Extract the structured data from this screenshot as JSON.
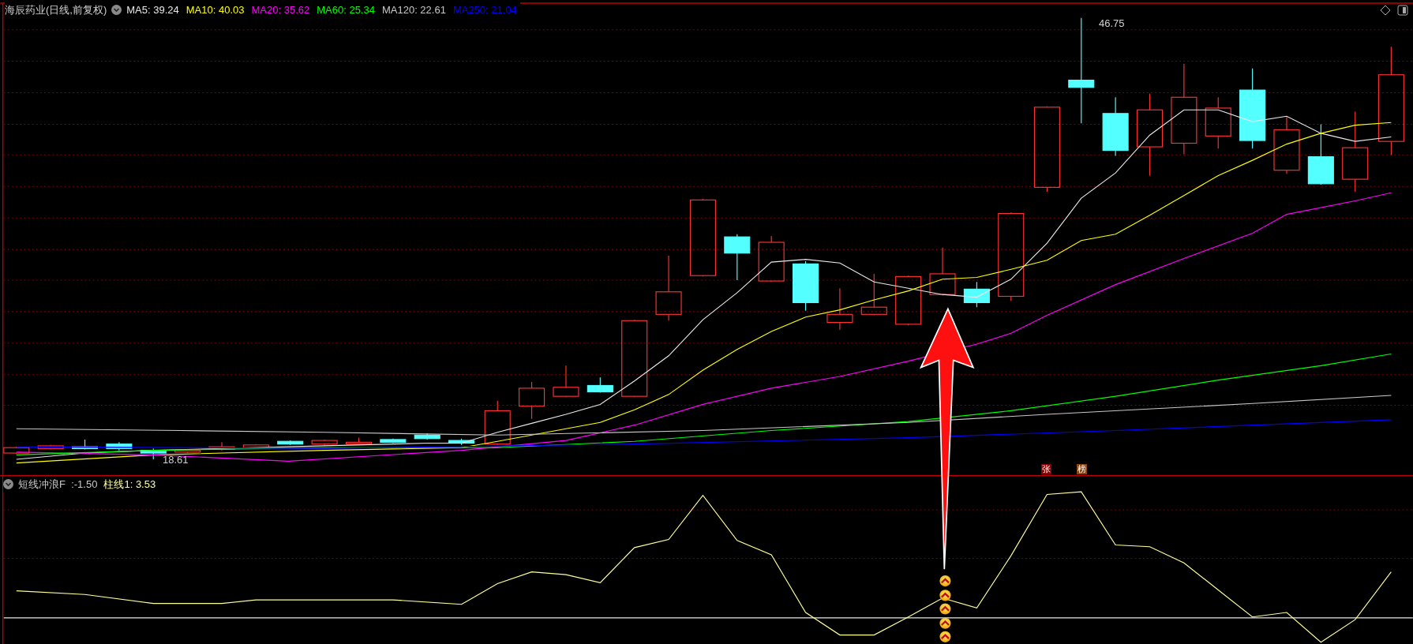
{
  "title": "海辰药业(日线,前复权)",
  "moving_averages": [
    {
      "label": "MA5: 39.24",
      "color": "#e8e8e8"
    },
    {
      "label": "MA10: 40.03",
      "color": "#ffff00"
    },
    {
      "label": "MA20: 35.62",
      "color": "#ff00ff"
    },
    {
      "label": "MA60: 25.34",
      "color": "#00ff00"
    },
    {
      "label": "MA120: 22.61",
      "color": "#c8c8c8"
    },
    {
      "label": "MA250: 21.04",
      "color": "#0000ff"
    }
  ],
  "high_label": "46.75",
  "low_label": "18.61",
  "indicator": {
    "items": [
      {
        "label": "短线冲浪F  :-1.50",
        "color": "#c8c8c8"
      },
      {
        "label": "柱线1: 3.53",
        "color": "#ffff99"
      }
    ]
  },
  "signal_badges": [
    {
      "text": "张",
      "color": "#8b0000"
    },
    {
      "text": "榜",
      "color": "#8b4513"
    }
  ]
}
